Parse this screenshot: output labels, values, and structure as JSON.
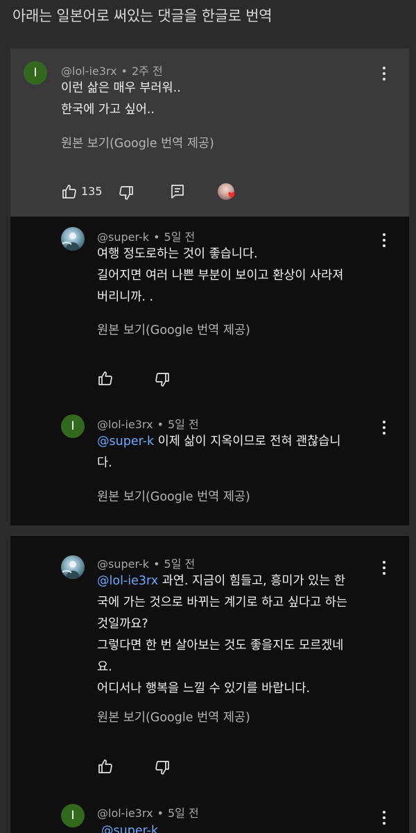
{
  "header": {
    "title": "아래는 일본어로 써있는 댓글을 한글로 번역"
  },
  "comments": [
    {
      "author": "@lol-ie3rx",
      "time": "2주 전",
      "avatar_initial": "I",
      "lines": [
        "이런 삶은 매우 부러워..",
        "한국에 가고 싶어.."
      ],
      "translate": "원본 보기(Google 번역 제공)",
      "likes": "135"
    },
    {
      "author": "@super-k",
      "time": "5일 전",
      "lines": [
        "여행 정도로하는 것이 좋습니다.",
        "길어지면 여러 나쁜 부분이 보이고 환상이 사라져",
        "버리니까. ."
      ],
      "translate": "원본 보기(Google 번역 제공)"
    },
    {
      "author": "@lol-ie3rx",
      "time": "5일 전",
      "avatar_initial": "I",
      "mention": "@super-k",
      "lines": [
        " 이제 삶이 지옥이므로 전혀 괜찮습니",
        "다."
      ],
      "translate": "원본 보기(Google 번역 제공)"
    },
    {
      "author": "@super-k",
      "time": "5일 전",
      "mention": "@lol-ie3rx",
      "lines": [
        " 과연. 지금이 힘들고, 흥미가 있는 한",
        "국에 가는 것으로 바뀌는 계기로 하고 싶다고 하는",
        "것일까요?",
        "그렇다면 한 번 살아보는 것도 좋을지도 모르겠네",
        "요.",
        "어디서나 행복을 느낄 수 있기를 바랍니다."
      ],
      "translate": "원본 보기(Google 번역 제공)"
    },
    {
      "author": "@lol-ie3rx",
      "time": "5일 전",
      "avatar_initial": "I",
      "mention": "@super-k"
    }
  ],
  "icons": {
    "like": "thumb-up-icon",
    "dislike": "thumb-down-icon",
    "reply": "reply-icon",
    "more": "more-vert-icon",
    "creator_heart": "creator-heart-icon"
  },
  "colors": {
    "mention": "#6ea8ff",
    "avatar_initial_bg": "#33691e",
    "highlight_bg": "#3a3a3a",
    "reply_bg": "#0f0f0f",
    "heart": "#ff2a2a"
  }
}
